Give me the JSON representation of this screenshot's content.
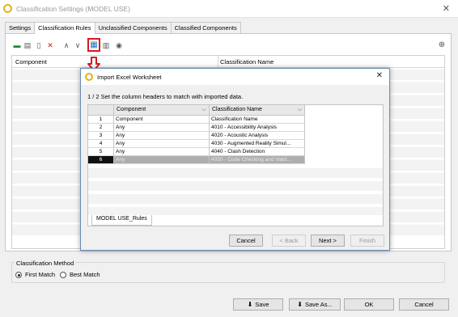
{
  "window": {
    "title": "Classification Settings (MODEL USE)",
    "close_glyph": "✕"
  },
  "tabs": [
    {
      "label": "Settings",
      "active": false
    },
    {
      "label": "Classification Rules",
      "active": true
    },
    {
      "label": "Unclassified Components",
      "active": false
    },
    {
      "label": "Classified Components",
      "active": false
    }
  ],
  "toolbar": {
    "icons": [
      "add-row-icon",
      "sheet-icon",
      "insert-column-icon",
      "delete-icon",
      "move-up-icon",
      "move-down-icon",
      "import-excel-icon",
      "export-icon",
      "hide-icon",
      "globe-icon"
    ],
    "highlight_color": "#d8191d"
  },
  "grid": {
    "columns": [
      "Component",
      "Classification Name"
    ]
  },
  "classification_method": {
    "legend": "Classification Method",
    "options": [
      {
        "label": "First Match",
        "selected": true
      },
      {
        "label": "Best Match",
        "selected": false
      }
    ]
  },
  "footer": {
    "save_label": "Save",
    "save_as_label": "Save As...",
    "ok_label": "OK",
    "cancel_label": "Cancel"
  },
  "dialog": {
    "title": "Import Excel Worksheet",
    "step_text": "1 / 2 Set the column headers to match with imported data.",
    "close_glyph": "✕",
    "columns": [
      "Component",
      "Classification Name"
    ],
    "rows": [
      {
        "num": "1",
        "component": "Component",
        "name": "Classification Name"
      },
      {
        "num": "2",
        "component": "Any",
        "name": "4010 - Accessibility Analysis"
      },
      {
        "num": "3",
        "component": "Any",
        "name": "4020 - Acoustic Analysis"
      },
      {
        "num": "4",
        "component": "Any",
        "name": "4030 - Augmented Reality Simul..."
      },
      {
        "num": "5",
        "component": "Any",
        "name": "4040 - Clash Detection"
      },
      {
        "num": "6",
        "component": "Any",
        "name": "4050 - Code Checking and Valid...",
        "selected": true
      }
    ],
    "sheet_tab": "MODEL USE_Rules",
    "buttons": {
      "cancel": "Cancel",
      "back": "< Back",
      "next": "Next >",
      "finish": "Finish"
    }
  },
  "colors": {
    "accent_red": "#d8191d",
    "app_icon": "#e3b21a",
    "dialog_border": "#6b8bb5"
  }
}
